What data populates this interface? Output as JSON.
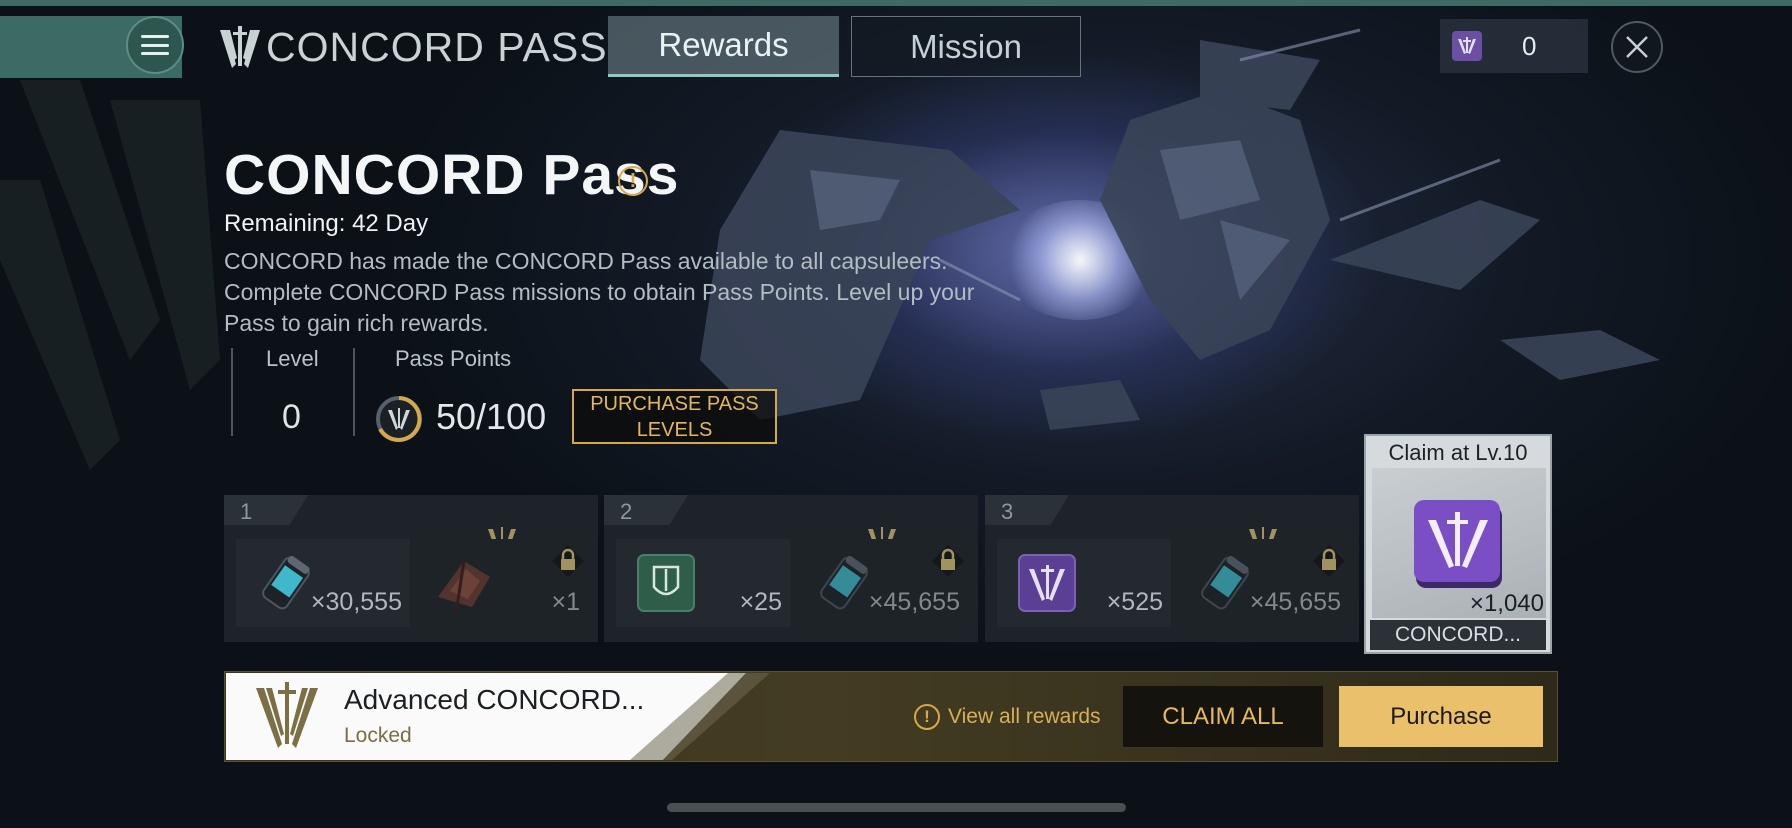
{
  "header": {
    "brand_title": "CONCORD PASS",
    "tabs": [
      {
        "label": "Rewards",
        "active": true
      },
      {
        "label": "Mission",
        "active": false
      }
    ],
    "currency_value": "0"
  },
  "pass": {
    "title": "CONCORD Pass",
    "remaining": "Remaining: 42 Day",
    "description": "CONCORD has made the CONCORD Pass available to all capsuleers. Complete CONCORD Pass missions to obtain Pass Points. Level up your Pass to gain rich rewards.",
    "level_label": "Level",
    "level_value": "0",
    "points_label": "Pass Points",
    "points_value": "50/100",
    "purchase_levels_label": "PURCHASE PASS LEVELS"
  },
  "levels": [
    {
      "number": "1",
      "free_qty": "×30,555",
      "free_icon": "canister-icon",
      "adv_qty": "×1",
      "adv_icon": "ship-icon"
    },
    {
      "number": "2",
      "free_qty": "×25",
      "free_icon": "green-badge-icon",
      "adv_qty": "×45,655",
      "adv_icon": "canister-icon"
    },
    {
      "number": "3",
      "free_qty": "×525",
      "free_icon": "purple-badge-icon",
      "adv_qty": "×45,655",
      "adv_icon": "canister-icon"
    }
  ],
  "final_reward": {
    "label": "Claim at Lv.10",
    "qty": "×1,040",
    "name": "CONCORD..."
  },
  "bottom": {
    "advanced_title": "Advanced CONCORD...",
    "advanced_status": "Locked",
    "view_all": "View all rewards",
    "claim_all": "CLAIM ALL",
    "purchase": "Purchase"
  },
  "colors": {
    "accent_teal": "#3b6b62",
    "gold": "#e6b95a",
    "purple": "#6b4fa3"
  }
}
